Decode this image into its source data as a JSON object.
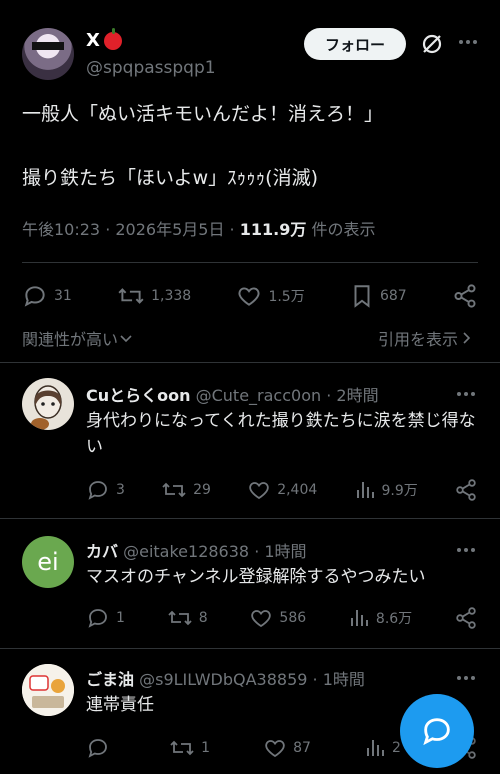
{
  "main_tweet": {
    "display_name": "X",
    "handle": "@spqpasspqp1",
    "follow_label": "フォロー",
    "text_line1": "一般人「ぬい活キモいんだよ！消えろ！」",
    "text_line2": "撮り鉄たち「ほいよw」ｽｩｩｩ(消滅)",
    "time": "午後10:23 · 2026年5月5日 ·",
    "views": "111.9万",
    "views_suffix": "件の表示",
    "replies": "31",
    "retweets": "1,338",
    "likes": "1.5万",
    "bookmarks": "687",
    "relevance_label": "関連性が高い",
    "quotes_label": "引用を表示"
  },
  "replies": [
    {
      "name": "Cuとらくoon",
      "handle": "@Cute_racc0on",
      "time": "· 2時間",
      "text": "身代わりになってくれた撮り鉄たちに涙を禁じ得ない",
      "replies": "3",
      "retweets": "29",
      "likes": "2,404",
      "views": "9.9万"
    },
    {
      "name": "カバ",
      "handle": "@eitake128638",
      "time": "· 1時間",
      "avatar_text": "ei",
      "avatar_color": "#6aa84f",
      "text": "マスオのチャンネル登録解除するやつみたい",
      "replies": "1",
      "retweets": "8",
      "likes": "586",
      "views": "8.6万"
    },
    {
      "name": "ごま油",
      "handle": "@s9LILWDbQA38859",
      "time": "· 1時間",
      "text": "連帯責任",
      "replies": "",
      "retweets": "1",
      "likes": "87",
      "views": "2"
    }
  ],
  "colors": {
    "accent": "#1d9bf0",
    "muted": "#71767b",
    "text": "#e7e9ea",
    "divider": "#2f3336"
  }
}
